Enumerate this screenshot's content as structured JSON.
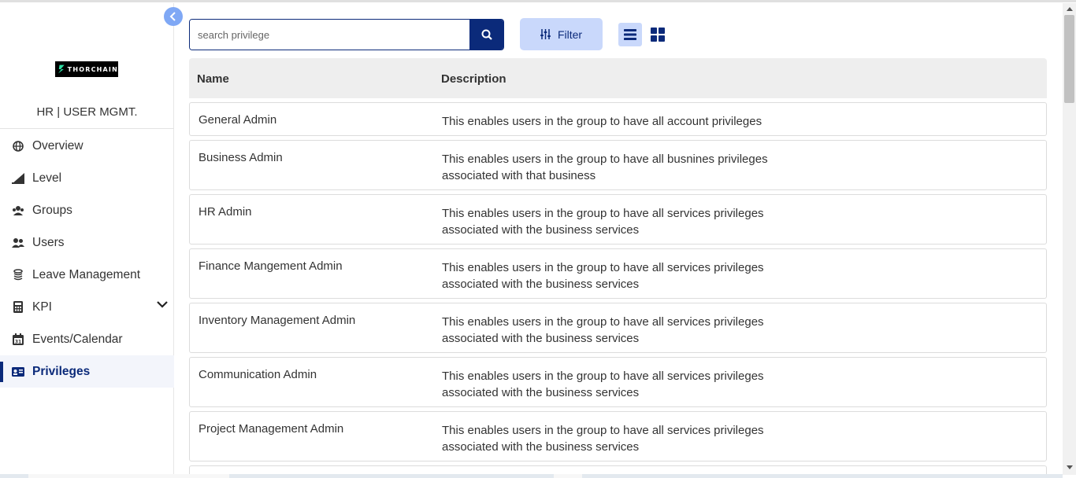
{
  "sidebar": {
    "logo_text": "THORCHAIN",
    "module_title": "HR | USER MGMT.",
    "items": [
      {
        "label": "Overview",
        "icon": "globe-icon"
      },
      {
        "label": "Level",
        "icon": "level-chart-icon"
      },
      {
        "label": "Groups",
        "icon": "groups-icon"
      },
      {
        "label": "Users",
        "icon": "users-icon"
      },
      {
        "label": "Leave Management",
        "icon": "coins-stack-icon"
      },
      {
        "label": "KPI",
        "icon": "calculator-icon"
      },
      {
        "label": "Events/Calendar",
        "icon": "calendar-icon"
      },
      {
        "label": "Privileges",
        "icon": "id-card-icon"
      }
    ],
    "active_item": "Privileges"
  },
  "search": {
    "placeholder": "search privilege",
    "value": ""
  },
  "toolbar": {
    "filter_label": "Filter",
    "view_mode": "list"
  },
  "table": {
    "columns": [
      "Name",
      "Description"
    ],
    "rows": [
      {
        "name": "General Admin",
        "desc1": "This enables users in the group to have all account privileges",
        "desc2": ""
      },
      {
        "name": "Business Admin",
        "desc1": "This enables users in the group to have all busnines privileges",
        "desc2": "associated with that business"
      },
      {
        "name": "HR Admin",
        "desc1": "This enables users in the group to have all services privileges",
        "desc2": "associated with the business services"
      },
      {
        "name": "Finance Mangement Admin",
        "desc1": "This enables users in the group to have all services privileges",
        "desc2": "associated with the business services"
      },
      {
        "name": "Inventory Management Admin",
        "desc1": "This enables users in the group to have all services privileges",
        "desc2": "associated with the business services"
      },
      {
        "name": "Communication Admin",
        "desc1": "This enables users in the group to have all services privileges",
        "desc2": "associated with the business services"
      },
      {
        "name": "Project Management Admin",
        "desc1": "This enables users in the group to have all services privileges",
        "desc2": "associated with the business services"
      }
    ]
  },
  "colors": {
    "primary": "#0b2a7a",
    "accent_light": "#c9d8fb",
    "collapse_button": "#7fa8f5",
    "header_bg": "#eeeeee"
  }
}
